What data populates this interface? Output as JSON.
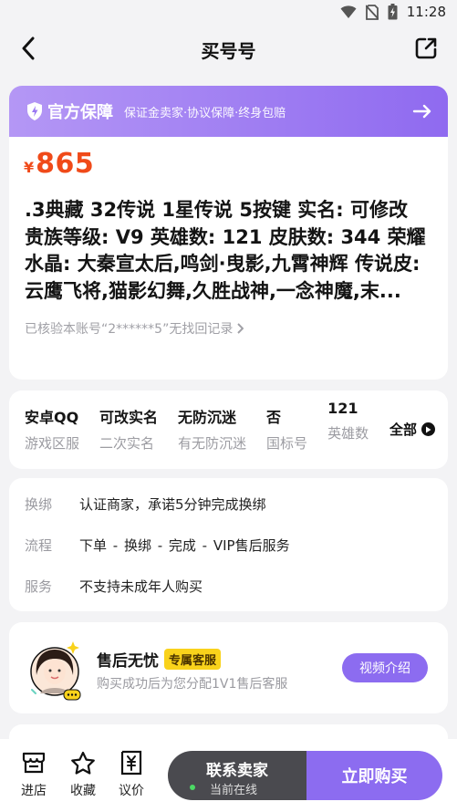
{
  "status_bar": {
    "time": "11:28",
    "icons": [
      "wifi-icon",
      "no-sim-icon",
      "battery-icon"
    ]
  },
  "header": {
    "title": "买号号",
    "back_icon": "back-arrow-icon",
    "share_icon": "share-icon"
  },
  "guarantee": {
    "title": "官方保障",
    "description": "保证金卖家·协议保障·终身包赔",
    "icon": "shield-icon",
    "arrow_icon": "arrow-right-icon"
  },
  "price": {
    "currency": "¥",
    "value": "865"
  },
  "listing": {
    "description": ".3典藏 32传说 1星传说 5按键 实名: 可修改 贵族等级: V9 英雄数: 121 皮肤数: 344 荣耀水晶: 大秦宣太后,鸣剑·曳影,九霄神辉 传说皮: 云鹰飞将,猫影幻舞,久胜战神,一念神魔,末...",
    "verify_text": "已核验本账号“2******5”无找回记录"
  },
  "attributes": {
    "items": [
      {
        "value": "安卓QQ",
        "label": "游戏区服"
      },
      {
        "value": "可改实名",
        "label": "二次实名"
      },
      {
        "value": "无防沉迷",
        "label": "有无防沉迷"
      },
      {
        "value": "否",
        "label": "国标号"
      },
      {
        "value": "121",
        "label": "英雄数"
      }
    ],
    "all_label": "全部"
  },
  "info": {
    "rows": [
      {
        "key": "换绑",
        "value": "认证商家，承诺5分钟完成换绑"
      },
      {
        "key": "流程",
        "value": "下单 - 换绑 - 完成 - VIP售后服务"
      },
      {
        "key": "服务",
        "value": "不支持未成年人购买"
      }
    ]
  },
  "service": {
    "title": "售后无忧",
    "badge": "专属客服",
    "description": "购买成功后为您分配1V1售后客服",
    "video_button": "视频介绍"
  },
  "bottom_bar": {
    "nav": [
      {
        "label": "进店",
        "icon": "store-icon"
      },
      {
        "label": "收藏",
        "icon": "star-icon"
      },
      {
        "label": "议价",
        "icon": "bargain-icon"
      }
    ],
    "contact": {
      "label": "联系卖家",
      "status": "当前在线"
    },
    "buy_label": "立即购买"
  },
  "colors": {
    "accent": "#8c6cf0",
    "price": "#f04a19",
    "badge": "#f9d21b",
    "dark_button": "#4a4a4f"
  }
}
